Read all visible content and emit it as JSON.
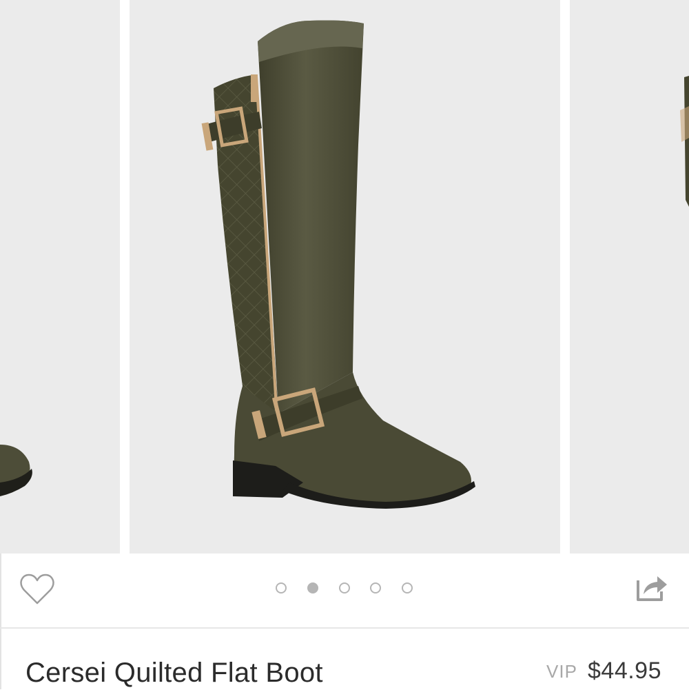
{
  "carousel": {
    "images": [
      {
        "id": "prev",
        "alt": "Boot toe, previous image"
      },
      {
        "id": "main",
        "alt": "Cersei Quilted Flat Boot"
      },
      {
        "id": "next",
        "alt": "Boot side, next image"
      }
    ],
    "dot_count": 5,
    "active_index": 1
  },
  "actions": {
    "favorite_icon": "heart-outline-icon",
    "share_icon": "share-icon"
  },
  "product": {
    "title": "Cersei Quilted Flat Boot",
    "vip_label": "VIP",
    "price": "$44.95"
  },
  "colors": {
    "boot": "#4a4a35",
    "hardware": "#c9a67a",
    "image_bg": "#ebebeb",
    "dot": "#b5b5b5"
  }
}
